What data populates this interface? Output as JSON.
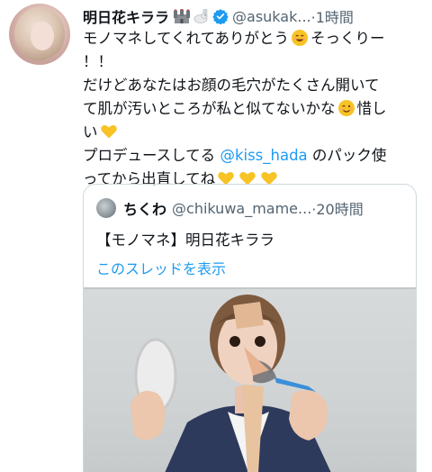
{
  "tweet": {
    "author_name": "明日花キララ",
    "handle": "@asukak...",
    "time": "·1時間",
    "lines": [
      "モノマネしてくれてありがとう",
      "そっくりー",
      "！！",
      "だけどあなたはお顔の毛穴がたくさん開いて",
      "て肌が汚いところが私と似てないかな",
      "惜し",
      "い",
      "プロデュースしてる ",
      "@kiss_hada",
      " のパック使",
      "ってから出直してね"
    ]
  },
  "quote": {
    "author_name": "ちくわ",
    "handle": "@chikuwa_mame...",
    "time": "·20時間",
    "text": "【モノマネ】明日花キララ",
    "thread_link": "このスレッドを表示"
  },
  "icons": {
    "avatar": "profile-avatar",
    "castle": "castle-emoji-icon",
    "rabbit": "rabbit-emoji-icon",
    "verified": "verified-badge-icon",
    "smile": "smile-emoji-icon",
    "wink": "wink-emoji-icon",
    "yellow_heart": "yellow-heart-emoji-icon"
  },
  "colors": {
    "link": "#1d9bf0",
    "secondary_text": "#536471",
    "verified": "#1d9bf0",
    "heart": "#f7c325"
  }
}
